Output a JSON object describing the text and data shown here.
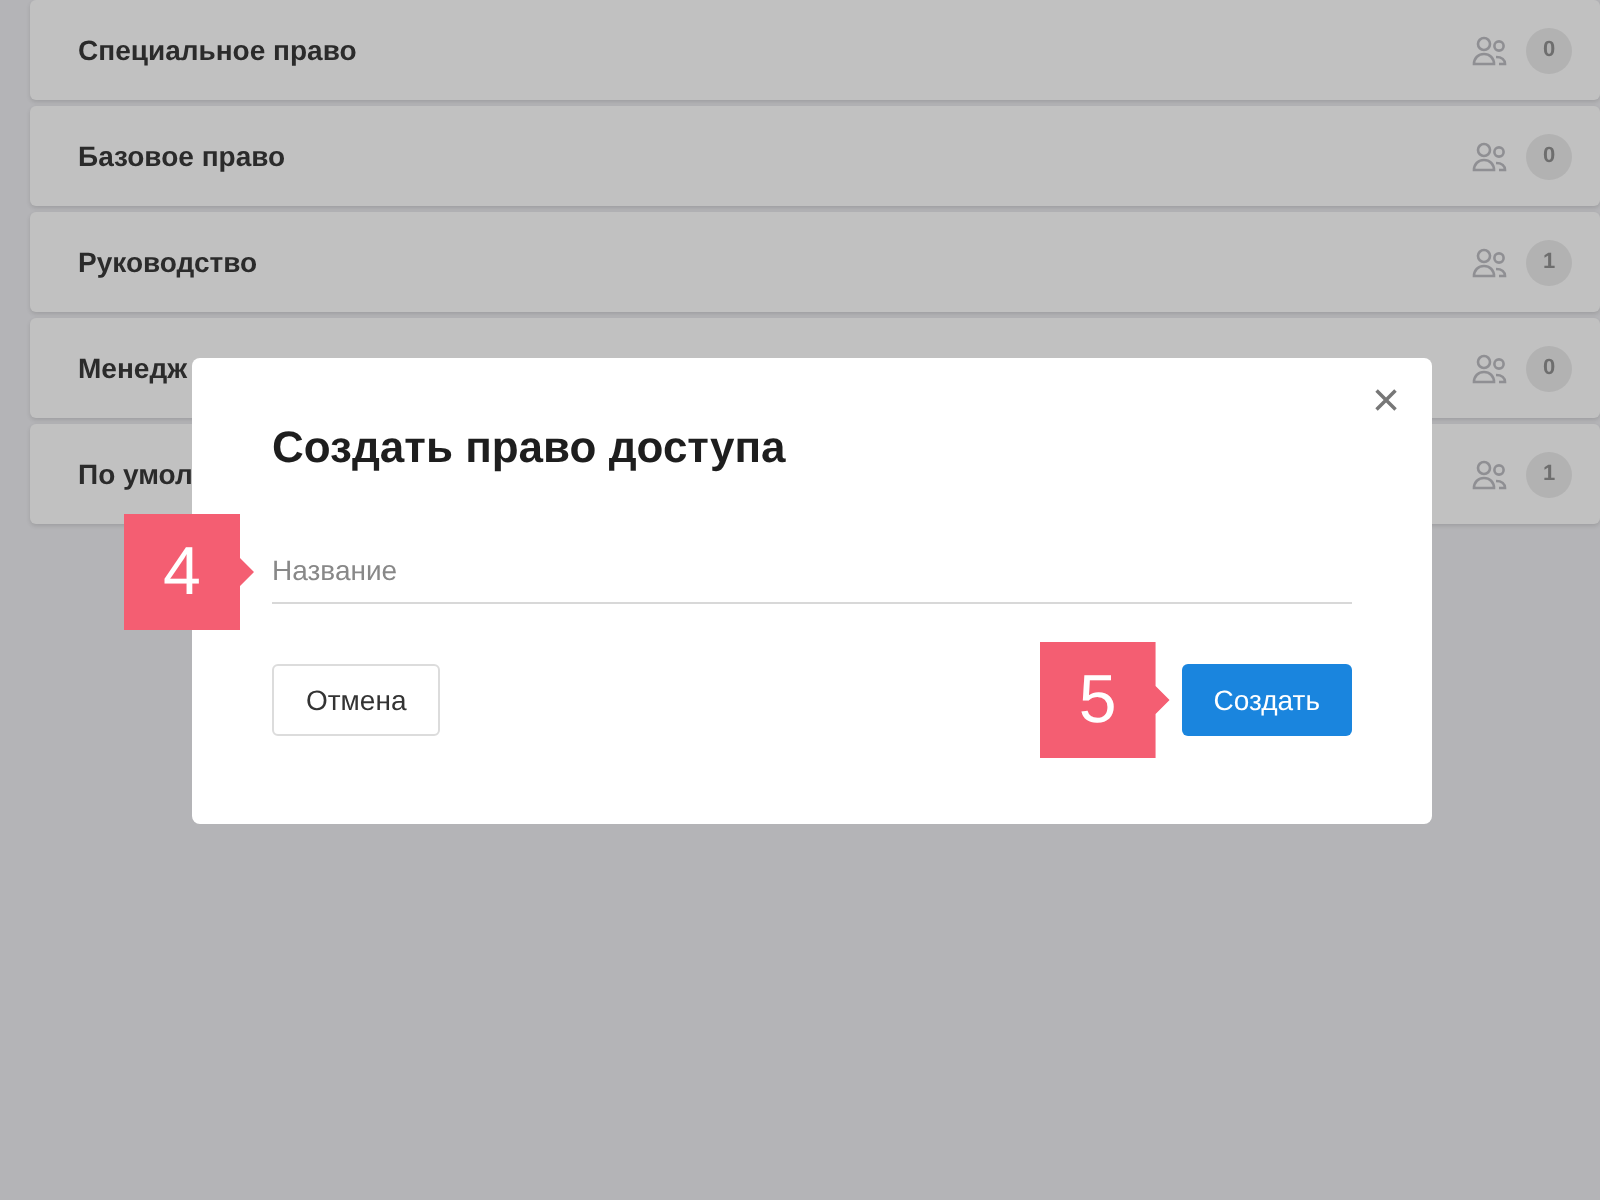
{
  "list": [
    {
      "name": "Специальное право",
      "count": "0"
    },
    {
      "name": "Базовое право",
      "count": "0"
    },
    {
      "name": "Руководство",
      "count": "1"
    },
    {
      "name": "Менедж",
      "count": "0"
    },
    {
      "name": "По умол",
      "count": "1"
    }
  ],
  "dialog": {
    "title": "Создать право доступа",
    "close": "×",
    "name_field": {
      "placeholder": "Название"
    },
    "cancel": "Отмена",
    "submit": "Создать"
  },
  "callouts": [
    {
      "kind": "field",
      "label": "4"
    },
    {
      "kind": "submit",
      "label": "5"
    }
  ]
}
